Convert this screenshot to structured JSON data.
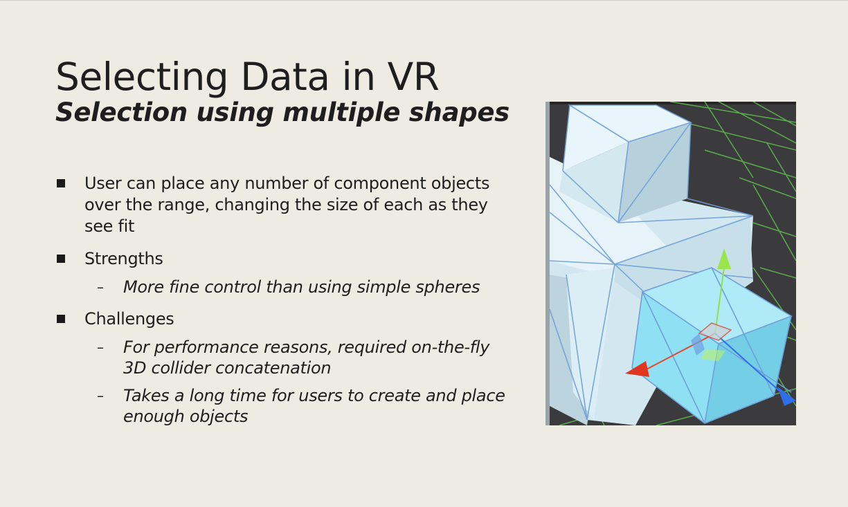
{
  "slide": {
    "title": "Selecting Data in VR",
    "subtitle": "Selection using multiple shapes"
  },
  "bullets": [
    {
      "text": "User can place any number of component objects over the range, changing the size of each as they see fit",
      "subs": []
    },
    {
      "text": "Strengths",
      "subs": [
        "More fine control than using simple spheres"
      ]
    },
    {
      "text": "Challenges",
      "subs": [
        "For performance reasons, required on-the-fly 3D collider concatenation",
        "Takes a long time for users to create and place enough objects"
      ]
    }
  ],
  "image": {
    "description_icon": "vr-collider-boxes-image",
    "colors": {
      "background": "#eeebe3",
      "grid_bg": "#3b3b3d",
      "grid_line": "#5fc24f",
      "box": "#d6ebf3",
      "selected_box": "#8fe0f2",
      "axis_x": "#e0351f",
      "axis_y": "#8fe04a",
      "axis_z": "#2f6ee8"
    }
  }
}
